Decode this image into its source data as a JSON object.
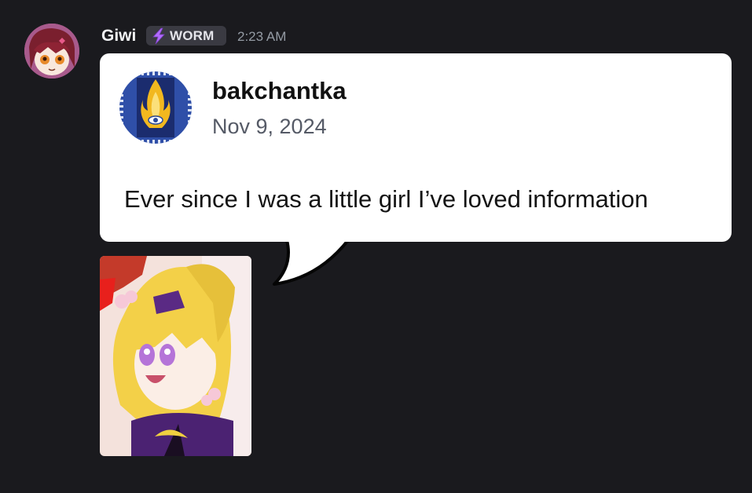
{
  "message": {
    "author": "Giwi",
    "badge": {
      "icon": "lightning-bolt-icon",
      "label": "WORM"
    },
    "timestamp": "2:23 AM",
    "avatar": "user-avatar"
  },
  "quote": {
    "author": "bakchantka",
    "date": "Nov 9, 2024",
    "text": "Ever since I was a little girl I’ve loved information",
    "avatar": "flaming-eye-avatar"
  },
  "attachment": {
    "type": "animated-image",
    "subject": "anime-girl-blonde-hair"
  },
  "colors": {
    "background": "#1a1a1e",
    "bubble": "#ffffff",
    "username": "#f2f3f5",
    "timestamp": "#949ba4",
    "badge_bg": "#3a3a42",
    "badge_icon": "#b26bff"
  }
}
